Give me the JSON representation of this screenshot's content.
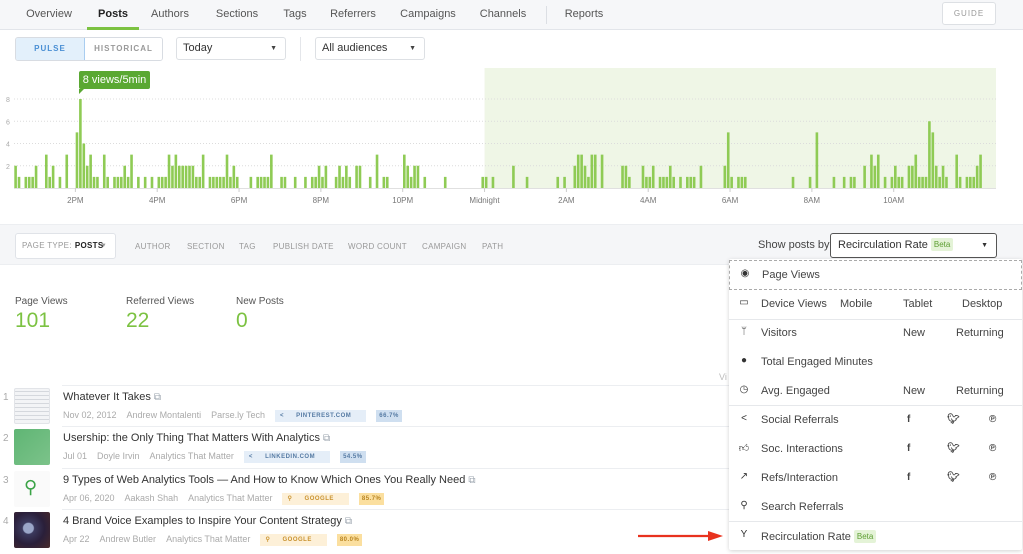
{
  "nav": {
    "tabs": [
      {
        "label": "Overview",
        "active": false
      },
      {
        "label": "Posts",
        "active": true
      },
      {
        "label": "Authors",
        "active": false
      },
      {
        "label": "Sections",
        "active": false
      },
      {
        "label": "Tags",
        "active": false
      },
      {
        "label": "Referrers",
        "active": false
      },
      {
        "label": "Campaigns",
        "active": false
      },
      {
        "label": "Channels",
        "active": false
      },
      {
        "label": "Reports",
        "active": false
      }
    ],
    "guide_label": "GUIDE"
  },
  "controls": {
    "mode_pulse": "PULSE",
    "mode_historical": "HISTORICAL",
    "mode_selected": "PULSE",
    "period": "Today",
    "audience": "All audiences"
  },
  "chart_data": {
    "type": "bar",
    "title": "",
    "xlabel": "",
    "ylabel": "",
    "unit": "views/5min",
    "ylim": [
      0,
      8
    ],
    "yticks": [
      2,
      4,
      6,
      8
    ],
    "grid": true,
    "slot_minutes": 5,
    "slot_count": 288,
    "x_tick_labels": [
      "2PM",
      "4PM",
      "6PM",
      "8PM",
      "10PM",
      "Midnight",
      "2AM",
      "4AM",
      "6AM",
      "8AM",
      "10AM"
    ],
    "x_tick_slots": [
      18,
      42,
      66,
      90,
      114,
      138,
      162,
      186,
      210,
      234,
      258
    ],
    "highlight_from_slot": 138,
    "highlight_color": "#eff6e6",
    "bar_color": "#8fcb55",
    "tooltip": {
      "text": "8 views/5min",
      "slot": 19,
      "value": 8
    },
    "bars": [
      [
        0,
        2
      ],
      [
        1,
        1
      ],
      [
        3,
        1
      ],
      [
        4,
        1
      ],
      [
        5,
        1
      ],
      [
        6,
        2
      ],
      [
        9,
        3
      ],
      [
        10,
        1
      ],
      [
        11,
        2
      ],
      [
        13,
        1
      ],
      [
        15,
        3
      ],
      [
        18,
        5
      ],
      [
        19,
        8
      ],
      [
        20,
        4
      ],
      [
        21,
        2
      ],
      [
        22,
        3
      ],
      [
        23,
        1
      ],
      [
        24,
        1
      ],
      [
        26,
        3
      ],
      [
        27,
        1
      ],
      [
        29,
        1
      ],
      [
        30,
        1
      ],
      [
        31,
        1
      ],
      [
        32,
        2
      ],
      [
        33,
        1
      ],
      [
        34,
        3
      ],
      [
        36,
        1
      ],
      [
        38,
        1
      ],
      [
        40,
        1
      ],
      [
        42,
        1
      ],
      [
        43,
        1
      ],
      [
        44,
        1
      ],
      [
        45,
        3
      ],
      [
        46,
        2
      ],
      [
        47,
        3
      ],
      [
        48,
        2
      ],
      [
        49,
        2
      ],
      [
        50,
        2
      ],
      [
        51,
        2
      ],
      [
        52,
        2
      ],
      [
        53,
        1
      ],
      [
        54,
        1
      ],
      [
        55,
        3
      ],
      [
        57,
        1
      ],
      [
        58,
        1
      ],
      [
        59,
        1
      ],
      [
        60,
        1
      ],
      [
        61,
        1
      ],
      [
        62,
        3
      ],
      [
        63,
        1
      ],
      [
        64,
        2
      ],
      [
        65,
        1
      ],
      [
        69,
        1
      ],
      [
        71,
        1
      ],
      [
        72,
        1
      ],
      [
        73,
        1
      ],
      [
        74,
        1
      ],
      [
        75,
        3
      ],
      [
        78,
        1
      ],
      [
        79,
        1
      ],
      [
        82,
        1
      ],
      [
        85,
        1
      ],
      [
        87,
        1
      ],
      [
        88,
        1
      ],
      [
        89,
        2
      ],
      [
        90,
        1
      ],
      [
        91,
        2
      ],
      [
        94,
        1
      ],
      [
        95,
        2
      ],
      [
        96,
        1
      ],
      [
        97,
        2
      ],
      [
        98,
        1
      ],
      [
        100,
        2
      ],
      [
        101,
        2
      ],
      [
        104,
        1
      ],
      [
        106,
        3
      ],
      [
        108,
        1
      ],
      [
        109,
        1
      ],
      [
        114,
        3
      ],
      [
        115,
        2
      ],
      [
        116,
        1
      ],
      [
        117,
        2
      ],
      [
        118,
        2
      ],
      [
        120,
        1
      ],
      [
        126,
        1
      ],
      [
        137,
        1
      ],
      [
        138,
        1
      ],
      [
        140,
        1
      ],
      [
        146,
        2
      ],
      [
        150,
        1
      ],
      [
        159,
        1
      ],
      [
        161,
        1
      ],
      [
        164,
        2
      ],
      [
        165,
        3
      ],
      [
        166,
        3
      ],
      [
        167,
        2
      ],
      [
        168,
        1
      ],
      [
        169,
        3
      ],
      [
        170,
        3
      ],
      [
        172,
        3
      ],
      [
        178,
        2
      ],
      [
        179,
        2
      ],
      [
        180,
        1
      ],
      [
        184,
        2
      ],
      [
        185,
        1
      ],
      [
        186,
        1
      ],
      [
        187,
        2
      ],
      [
        189,
        1
      ],
      [
        190,
        1
      ],
      [
        191,
        1
      ],
      [
        192,
        2
      ],
      [
        193,
        1
      ],
      [
        195,
        1
      ],
      [
        197,
        1
      ],
      [
        198,
        1
      ],
      [
        199,
        1
      ],
      [
        201,
        2
      ],
      [
        208,
        2
      ],
      [
        209,
        5
      ],
      [
        210,
        1
      ],
      [
        212,
        1
      ],
      [
        213,
        1
      ],
      [
        214,
        1
      ],
      [
        228,
        1
      ],
      [
        233,
        1
      ],
      [
        235,
        5
      ],
      [
        240,
        1
      ],
      [
        243,
        1
      ],
      [
        245,
        1
      ],
      [
        246,
        1
      ],
      [
        249,
        2
      ],
      [
        251,
        3
      ],
      [
        252,
        2
      ],
      [
        253,
        3
      ],
      [
        255,
        1
      ],
      [
        257,
        1
      ],
      [
        258,
        2
      ],
      [
        259,
        1
      ],
      [
        260,
        1
      ],
      [
        262,
        2
      ],
      [
        263,
        2
      ],
      [
        264,
        3
      ],
      [
        265,
        1
      ],
      [
        266,
        1
      ],
      [
        267,
        1
      ],
      [
        268,
        6
      ],
      [
        269,
        5
      ],
      [
        270,
        2
      ],
      [
        271,
        1
      ],
      [
        272,
        2
      ],
      [
        273,
        1
      ],
      [
        276,
        3
      ],
      [
        277,
        1
      ],
      [
        279,
        1
      ],
      [
        280,
        1
      ],
      [
        281,
        1
      ],
      [
        282,
        2
      ],
      [
        283,
        3
      ]
    ]
  },
  "filters": {
    "page_type_label": "PAGE TYPE:",
    "page_type_value": "POSTS",
    "items": [
      "AUTHOR",
      "SECTION",
      "TAG",
      "PUBLISH DATE",
      "WORD COUNT",
      "CAMPAIGN",
      "PATH"
    ],
    "show_by_label": "Show posts by:",
    "show_by_value": "Recirculation Rate",
    "show_by_badge": "Beta"
  },
  "metrics": [
    {
      "label": "Page Views",
      "value": "101"
    },
    {
      "label": "Referred Views",
      "value": "22"
    },
    {
      "label": "New Posts",
      "value": "0"
    }
  ],
  "posts": [
    {
      "rank": "1",
      "title": "Whatever It Takes",
      "date": "Nov 02, 2012",
      "author": "Andrew Montalenti",
      "section": "Parse.ly Tech",
      "referrer": "PINTEREST.COM",
      "referrer_icon": "share-icon",
      "share": "66.7%",
      "badge_color": "blue",
      "thumb": "screenshot"
    },
    {
      "rank": "2",
      "title": "Usership: the Only Thing That Matters With Analytics",
      "date": "Jul 01",
      "author": "Doyle Irvin",
      "section": "Analytics That Matter",
      "referrer": "LINKEDIN.COM",
      "referrer_icon": "share-icon",
      "share": "54.5%",
      "badge_color": "blue",
      "thumb": "green"
    },
    {
      "rank": "3",
      "title": "9 Types of Web Analytics Tools — And How to Know Which Ones You Really Need",
      "date": "Apr 06, 2020",
      "author": "Aakash Shah",
      "section": "Analytics That Matter",
      "referrer": "GOOGLE",
      "referrer_icon": "search-icon",
      "share": "85.7%",
      "badge_color": "orange",
      "thumb": "magnifier"
    },
    {
      "rank": "4",
      "title": "4 Brand Voice Examples to Inspire Your Content Strategy",
      "date": "Apr 22",
      "author": "Andrew Butler",
      "section": "Analytics That Matter",
      "referrer": "GOOGLE",
      "referrer_icon": "search-icon",
      "share": "80.0%",
      "badge_color": "orange",
      "thumb": "microphone"
    }
  ],
  "hidden_column_fragment": "Vi",
  "menu": {
    "items": [
      {
        "icon": "eye-icon",
        "label": "Page Views",
        "cols": []
      },
      {
        "icon": "devices-icon",
        "label": "Device Views",
        "cols": [
          "Mobile",
          "Tablet",
          "Desktop"
        ]
      },
      {
        "icon": "visitors-icon",
        "label": "Visitors",
        "cols": [
          "New",
          "Returning"
        ]
      },
      {
        "icon": "stopwatch-filled-icon",
        "label": "Total Engaged Minutes",
        "cols": []
      },
      {
        "icon": "stopwatch-icon",
        "label": "Avg. Engaged",
        "cols": [
          "New",
          "Returning"
        ]
      },
      {
        "icon": "share-icon",
        "label": "Social Referrals",
        "cols": [
          "f",
          "twitter",
          "pinterest"
        ]
      },
      {
        "icon": "thumbs-up-icon",
        "label": "Soc. Interactions",
        "cols": [
          "f",
          "twitter",
          "pinterest"
        ]
      },
      {
        "icon": "trend-up-icon",
        "label": "Refs/Interaction",
        "cols": [
          "f",
          "twitter",
          "pinterest"
        ]
      },
      {
        "icon": "search-icon",
        "label": "Search Referrals",
        "cols": []
      },
      {
        "icon": "recirculation-icon",
        "label": "Recirculation Rate",
        "badge": "Beta",
        "cols": []
      }
    ]
  },
  "annotation": {
    "arrow_color": "#e8321e",
    "points_to": "Recirculation Rate"
  }
}
